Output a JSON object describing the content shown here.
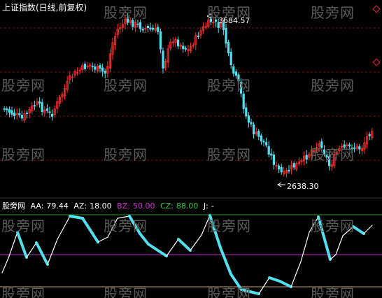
{
  "title": "上证指数(日线,前复权)",
  "watermark": "股旁网",
  "indicator": {
    "name": "股旁网",
    "aa_label": "AA:",
    "aa_value": "79.44",
    "az_label": "AZ:",
    "az_value": "18.00",
    "bz_label": "BZ:",
    "bz_value": "50.00",
    "cz_label": "CZ:",
    "cz_value": "88.00",
    "j_label": "J:",
    "j_value": "-"
  },
  "price": {
    "high_label": "3684.57",
    "low_label": "2638.30"
  },
  "colors": {
    "up": "#ff3030",
    "down": "#52e0f0",
    "grid": "#7a0d0d",
    "bz": "#cc33cc",
    "cz": "#33cc33",
    "cz_line": "#2a9a2a",
    "bz_line": "#bb33bb",
    "base_line": "#c8a070",
    "j_line": "#ffffff",
    "j_rise": "#52e0f0"
  },
  "icons": [
    "diamond-marker-icon"
  ]
}
